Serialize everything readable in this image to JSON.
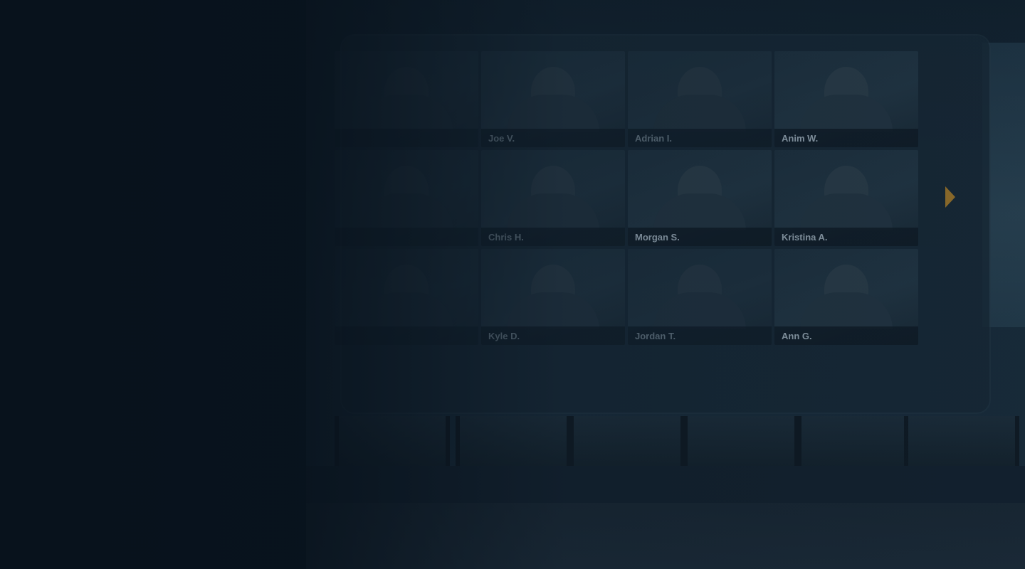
{
  "hero": {
    "participants": [
      {
        "name": ""
      },
      {
        "name": "Joe V."
      },
      {
        "name": "Adrian I."
      },
      {
        "name": "Anim W."
      },
      {
        "name": ""
      },
      {
        "name": "Chris H."
      },
      {
        "name": "Morgan S."
      },
      {
        "name": "Kristina A."
      },
      {
        "name": ""
      },
      {
        "name": "Kyle D."
      },
      {
        "name": "Jordan T."
      },
      {
        "name": "Ann G."
      }
    ],
    "next_icon": "chevron-right-icon",
    "accent_color": "#b8862a"
  }
}
